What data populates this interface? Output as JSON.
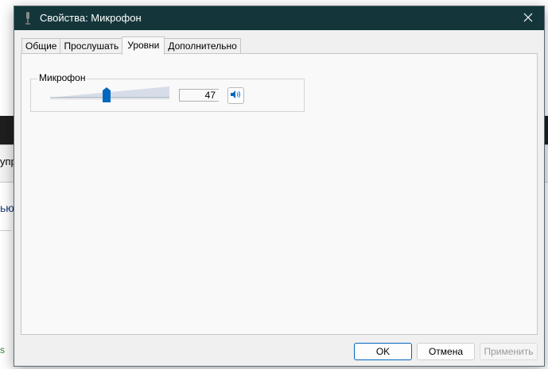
{
  "background": {
    "toolbar_text": "упр",
    "link_text": "ью",
    "green_text": "s"
  },
  "dialog": {
    "title": "Свойства: Микрофон",
    "icons": {
      "title": "microphone-icon",
      "close": "close-icon",
      "speaker": "speaker-icon"
    },
    "tabs": [
      {
        "label": "Общие",
        "active": false
      },
      {
        "label": "Прослушать",
        "active": false
      },
      {
        "label": "Уровни",
        "active": true
      },
      {
        "label": "Дополнительно",
        "active": false
      }
    ],
    "levels": {
      "group_label": "Микрофон",
      "value": "47",
      "slider_fraction": 0.47
    },
    "buttons": {
      "ok": "OK",
      "cancel": "Отмена",
      "apply": "Применить"
    }
  },
  "colors": {
    "titlebar": "#14363a",
    "accent": "#0067c0"
  }
}
